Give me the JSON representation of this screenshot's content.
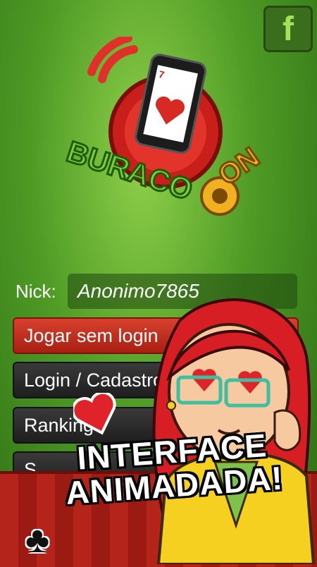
{
  "app": {
    "logo_text": "BURACOON"
  },
  "header": {
    "facebook_label": "f"
  },
  "form": {
    "nick_label": "Nick:",
    "nick_value": "Anonimo7865"
  },
  "buttons": [
    {
      "label": "Jogar sem login"
    },
    {
      "label": "Login / Cadastro"
    },
    {
      "label": "Ranking"
    },
    {
      "label": "S"
    }
  ],
  "banner": {
    "line1": "INTERFACE",
    "line2": "ANIMADADA!"
  },
  "colors": {
    "background": "#4e9b25",
    "primary_button": "#c4301f",
    "dark_button": "#2a2a2a",
    "banner": "#b5241b"
  },
  "icons": [
    "facebook-icon",
    "phone-heart-icon",
    "heart-icon",
    "club-suit-icon"
  ]
}
